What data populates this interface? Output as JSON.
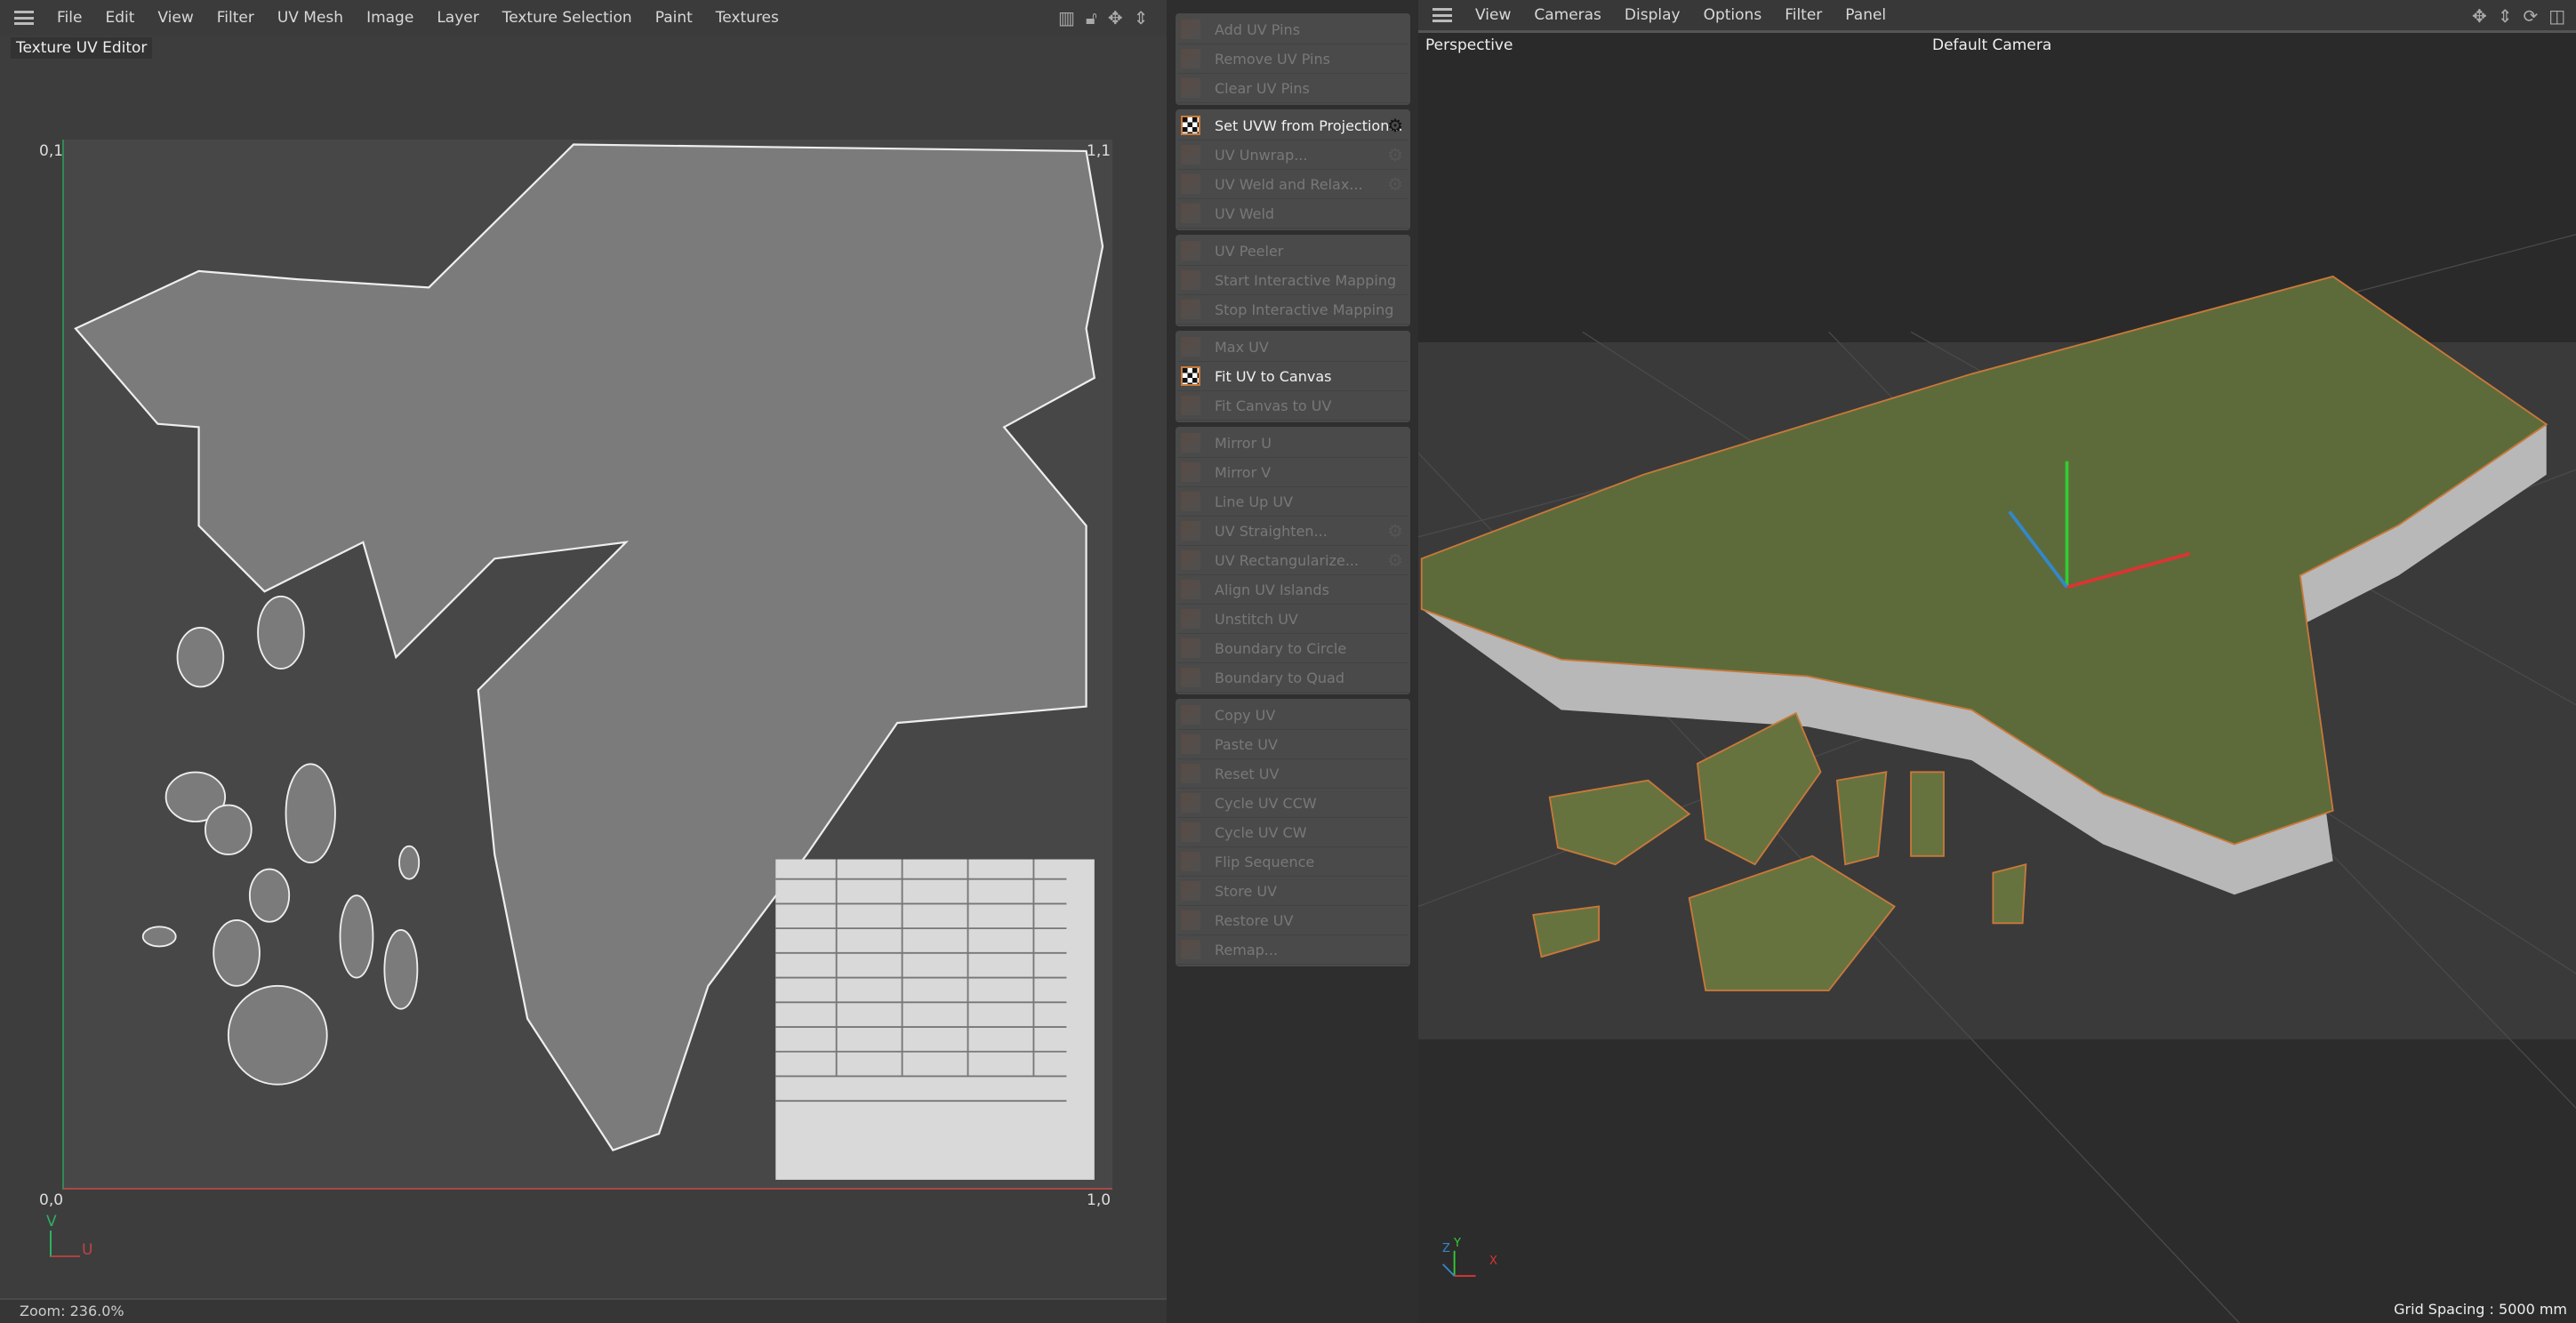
{
  "uv_editor": {
    "menu": [
      "File",
      "Edit",
      "View",
      "Filter",
      "UV Mesh",
      "Image",
      "Layer",
      "Texture Selection",
      "Paint",
      "Textures"
    ],
    "title": "Texture UV Editor",
    "corners": {
      "top_left": "0,1",
      "top_right": "1,1",
      "bottom_left": "0,0",
      "bottom_right": "1,0"
    },
    "axis": {
      "v": "V",
      "u": "U"
    },
    "zoom": "Zoom: 236.0%"
  },
  "tools": {
    "groups": [
      [
        {
          "label": "Add UV Pins"
        },
        {
          "label": "Remove UV Pins"
        },
        {
          "label": "Clear UV Pins"
        }
      ],
      [
        {
          "label": "Set UVW from Projection...",
          "active": true,
          "gear": true
        },
        {
          "label": "UV Unwrap...",
          "gear": true
        },
        {
          "label": "UV Weld and Relax...",
          "gear": true
        },
        {
          "label": "UV Weld"
        }
      ],
      [
        {
          "label": "UV Peeler"
        },
        {
          "label": "Start Interactive Mapping"
        },
        {
          "label": "Stop Interactive Mapping"
        }
      ],
      [
        {
          "label": "Max UV"
        },
        {
          "label": "Fit UV to Canvas",
          "active": true
        },
        {
          "label": "Fit Canvas to UV"
        }
      ],
      [
        {
          "label": "Mirror U"
        },
        {
          "label": "Mirror V"
        },
        {
          "label": "Line Up UV"
        },
        {
          "label": "UV Straighten...",
          "gear": true
        },
        {
          "label": "UV Rectangularize...",
          "gear": true
        },
        {
          "label": "Align UV Islands"
        },
        {
          "label": "Unstitch UV"
        },
        {
          "label": "Boundary to Circle"
        },
        {
          "label": "Boundary to Quad"
        }
      ],
      [
        {
          "label": "Copy UV"
        },
        {
          "label": "Paste UV"
        },
        {
          "label": "Reset UV"
        },
        {
          "label": "Cycle UV CCW"
        },
        {
          "label": "Cycle UV CW"
        },
        {
          "label": "Flip Sequence"
        },
        {
          "label": "Store UV"
        },
        {
          "label": "Restore UV"
        },
        {
          "label": "Remap..."
        }
      ]
    ]
  },
  "viewport": {
    "menu": [
      "View",
      "Cameras",
      "Display",
      "Options",
      "Filter",
      "Panel"
    ],
    "projection": "Perspective",
    "camera": "Default Camera",
    "grid_spacing": "Grid Spacing : 5000 mm",
    "axis": {
      "z": "Z",
      "y": "Y",
      "x": "X"
    }
  }
}
